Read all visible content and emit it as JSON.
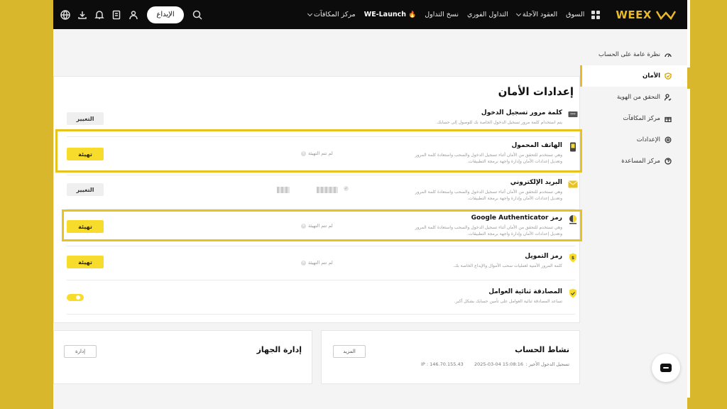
{
  "topbar": {
    "logo_text": "WEEX",
    "nav": [
      {
        "label": "السوق"
      },
      {
        "label": "العقود الآجلة",
        "dropdown": true
      },
      {
        "label": "التداول الفوري"
      },
      {
        "label": "نسخ التداول"
      },
      {
        "label": "WE-Launch",
        "icon": "fire-icon"
      },
      {
        "label": "مركز المكافآت",
        "dropdown": true
      }
    ],
    "deposit_label": "الإيداع"
  },
  "sidebar": {
    "items": [
      {
        "label": "نظرة عامة على الحساب",
        "icon": "dashboard-icon"
      },
      {
        "label": "الأمان",
        "icon": "shield-icon",
        "active": true
      },
      {
        "label": "التحقق من الهوية",
        "icon": "user-check-icon"
      },
      {
        "label": "مركز المكافآت",
        "icon": "gift-icon"
      },
      {
        "label": "الإعدادات",
        "icon": "gear-icon"
      },
      {
        "label": "مركز المساعدة",
        "icon": "help-icon"
      }
    ]
  },
  "security": {
    "title": "إعدادات الأمان",
    "rows": [
      {
        "title": "كلمة مرور تسجيل الدخول",
        "desc": "يتم استخدام كلمة مرور تسجيل الدخول الخاصة بك للوصول إلى حسابك.",
        "button": "التغيير"
      },
      {
        "title": "الهاتف المحمول",
        "desc": "وهي تستخدم للتحقق من الأمان أثناء تسجيل الدخول والسحب واستعادة كلمة المرور وتعديل إعدادات الأمان وإدارة واجهة برمجة التطبيقات.",
        "status": "لم تتم التهيئة",
        "button": "تهيئة"
      },
      {
        "title": "البريد الإلكتروني",
        "desc": "وهي تستخدم للتحقق من الأمان أثناء تسجيل الدخول والسحب واستعادة كلمة المرور وتعديل إعدادات الأمان وإدارة واجهة برمجة التطبيقات.",
        "button": "التغيير"
      },
      {
        "title": "رمز Google Authenticator",
        "desc": "وهي تستخدم للتحقق من الأمان أثناء تسجيل الدخول والسحب واستعادة كلمة المرور وتعديل إعدادات الأمان وإدارة واجهة برمجة التطبيقات.",
        "status": "لم تتم التهيئة",
        "button": "تهيئة"
      },
      {
        "title": "رمز التمويل",
        "desc": "كلمة المرور الأمنية لعمليات سحب الأموال والإيداع الخاصة بك.",
        "status": "لم تتم التهيئة",
        "button": "تهيئة"
      },
      {
        "title": "المصادقة ثنائية العوامل",
        "desc": "تساعد المصادقة ثنائية العوامل على تأمين حسابك بشكل أكبر.",
        "toggle": "on"
      }
    ]
  },
  "activity": {
    "title": "نشاط الحساب",
    "more_label": "المزيد",
    "last_login_label": "تسجيل الدخول الأخير :",
    "last_login_time": "2025-03-04 15:08:16",
    "ip_label": "IP : 146.70.155.43"
  },
  "device": {
    "title": "إدارة الجهاز",
    "manage_label": "إدارة"
  },
  "colors": {
    "accent": "#f7dc2b",
    "highlight": "#e8c21f",
    "topbar": "#0c0c0c"
  }
}
